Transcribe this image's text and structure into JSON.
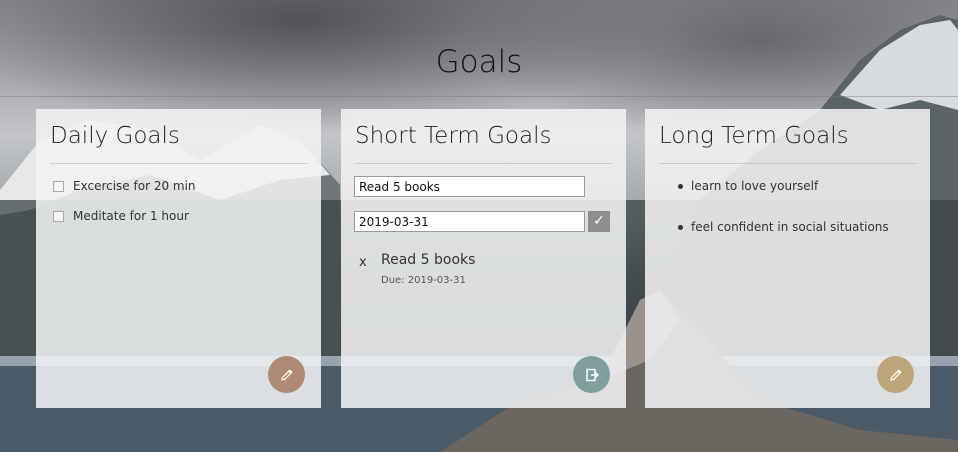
{
  "page": {
    "title": "Goals"
  },
  "daily": {
    "title": "Daily Goals",
    "items": [
      {
        "label": "Excercise for 20 min",
        "checked": false
      },
      {
        "label": "Meditate for 1 hour",
        "checked": false
      }
    ],
    "edit_icon": "pencil-icon",
    "button_color": "#b08a72"
  },
  "short_term": {
    "title": "Short Term Goals",
    "goal_input_value": "Read 5 books",
    "date_input_value": "2019-03-31",
    "submit_icon": "checkmark-icon",
    "submit_glyph": "✓",
    "goals": [
      {
        "remove_label": "x",
        "name": "Read 5 books",
        "due": "Due: 2019-03-31"
      }
    ],
    "exit_icon": "exit-icon",
    "button_color": "#7f9ea0"
  },
  "long_term": {
    "title": "Long Term Goals",
    "items": [
      "learn to love yourself",
      "feel confident in social situations"
    ],
    "edit_icon": "pencil-icon",
    "button_color": "#bfa57a"
  }
}
